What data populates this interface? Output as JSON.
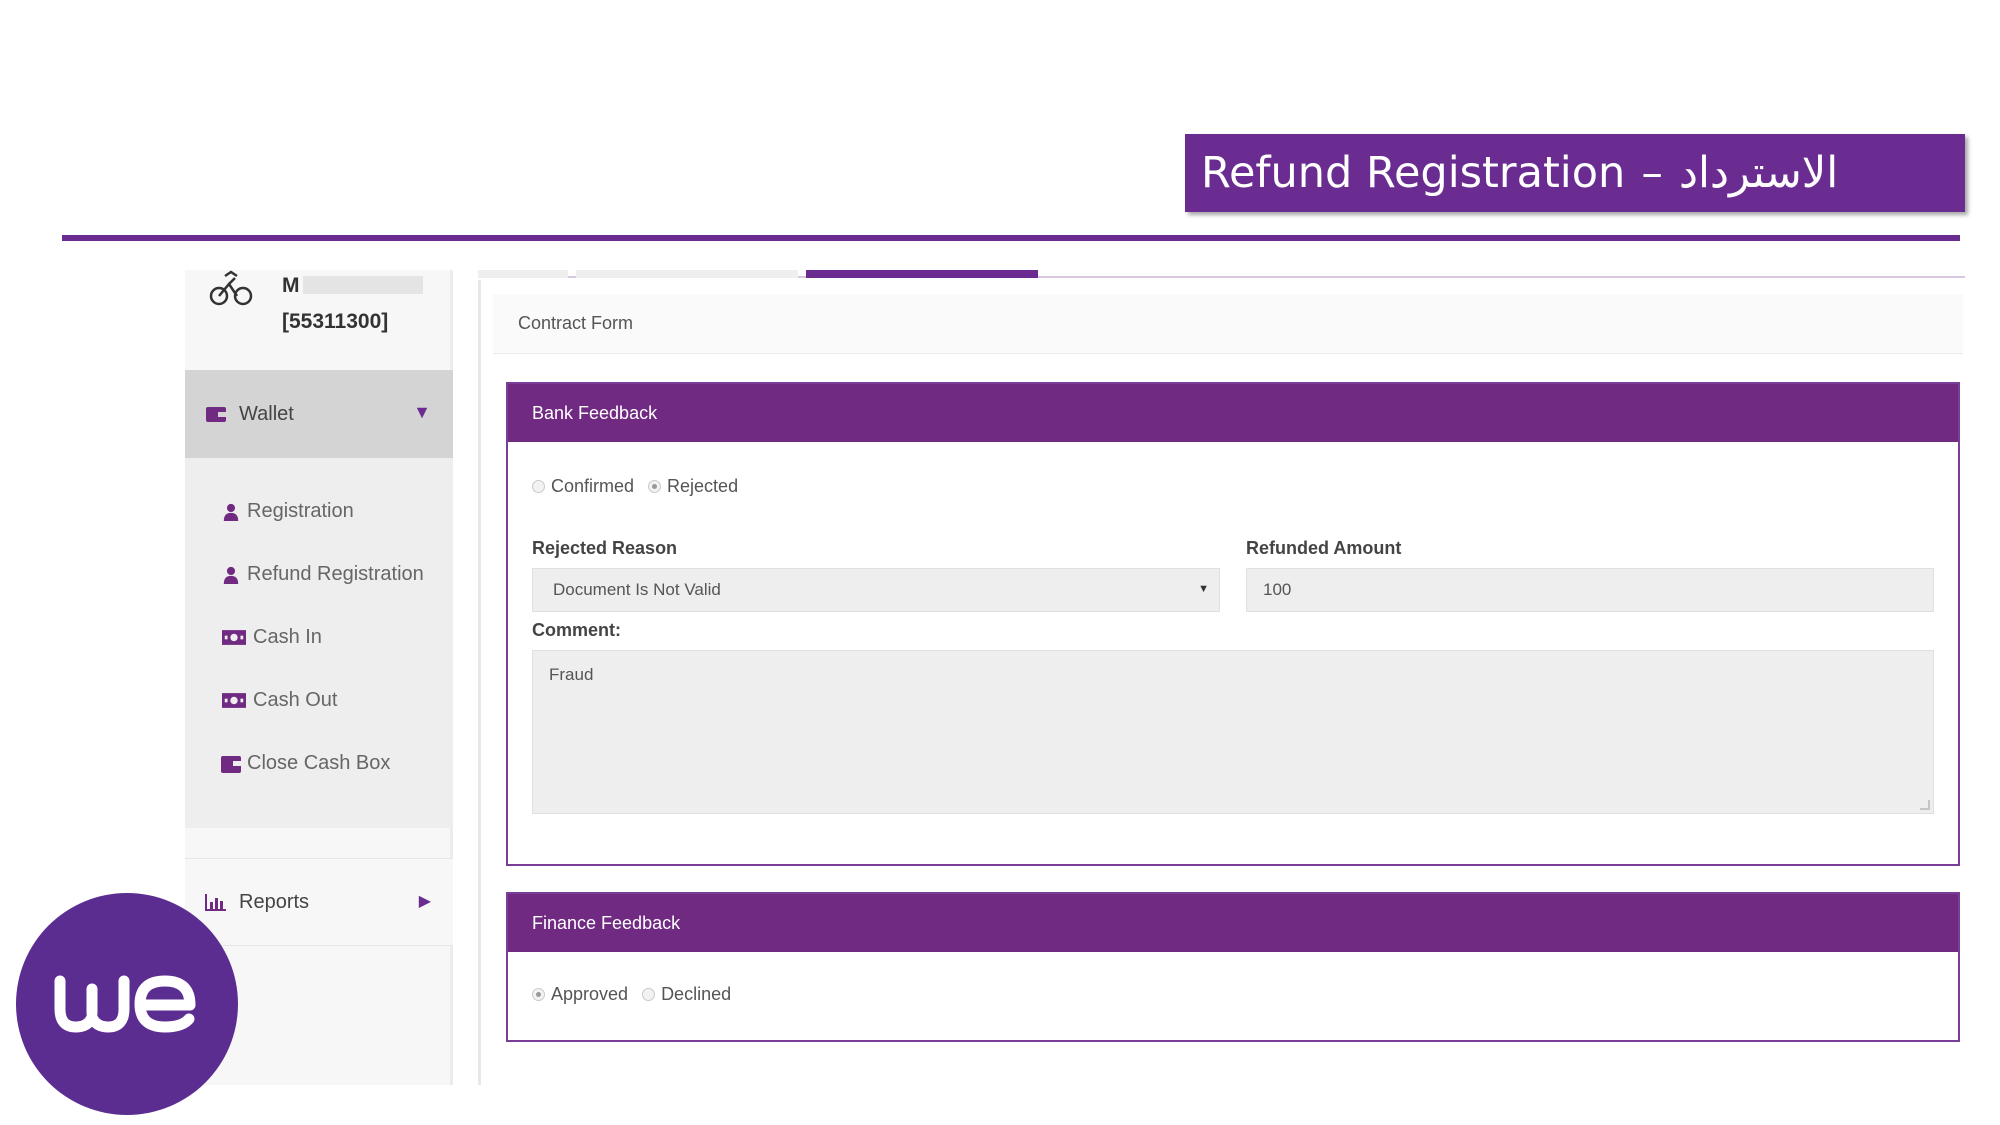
{
  "slide": {
    "title_en": "Refund Registration",
    "title_sep": "–",
    "title_ar": "الاسترداد",
    "brand_color": "#6a2c91"
  },
  "sidebar": {
    "user": {
      "name_visible": "M",
      "account_id": "[55311300]",
      "icon": "user-bike-icon"
    },
    "wallet": {
      "label": "Wallet",
      "icon": "wallet-icon",
      "expanded": true
    },
    "items": [
      {
        "label": "Registration",
        "icon": "user-icon"
      },
      {
        "label": "Refund Registration",
        "icon": "user-icon"
      },
      {
        "label": "Cash In",
        "icon": "money-icon"
      },
      {
        "label": "Cash Out",
        "icon": "money-icon"
      },
      {
        "label": "Close Cash Box",
        "icon": "wallet-icon"
      }
    ],
    "reports": {
      "label": "Reports",
      "icon": "bar-chart-icon",
      "expanded": false
    }
  },
  "content": {
    "header": "Contract Form",
    "bank_feedback": {
      "title": "Bank Feedback",
      "options": [
        {
          "label": "Confirmed",
          "selected": false
        },
        {
          "label": "Rejected",
          "selected": true
        }
      ],
      "rejected_reason_label": "Rejected Reason",
      "rejected_reason_value": "Document Is Not Valid",
      "refunded_amount_label": "Refunded Amount",
      "refunded_amount_value": "100",
      "comment_label": "Comment:",
      "comment_value": "Fraud"
    },
    "finance_feedback": {
      "title": "Finance Feedback",
      "options": [
        {
          "label": "Approved",
          "selected": true
        },
        {
          "label": "Declined",
          "selected": false
        }
      ]
    }
  },
  "logo": {
    "text": "we",
    "color": "#5b2d90"
  }
}
